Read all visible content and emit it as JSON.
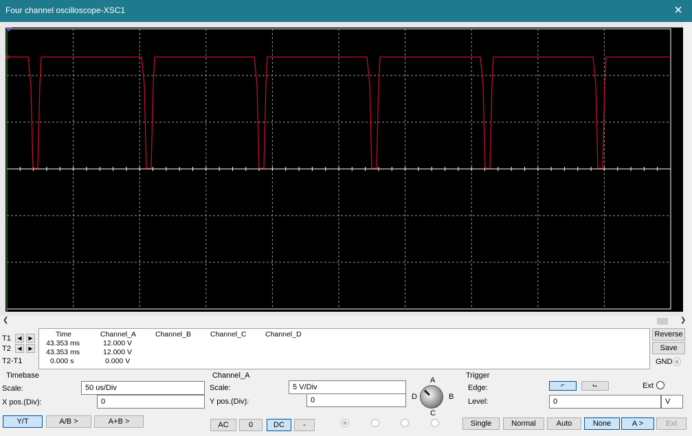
{
  "window": {
    "title": "Four channel oscilloscope-XSC1",
    "close_icon": "×"
  },
  "colors": {
    "trace": "#c8102e",
    "screen": "#000000",
    "grid": "#9a9a9a",
    "titlebar": "#1e7a8c"
  },
  "readout": {
    "t1_label": "T1",
    "t2_label": "T2",
    "t2t1_label": "T2-T1",
    "headers": [
      "Time",
      "Channel_A",
      "Channel_B",
      "Channel_C",
      "Channel_D"
    ],
    "rows": [
      [
        "43.353 ms",
        "12.000 V",
        "",
        "",
        ""
      ],
      [
        "43.353 ms",
        "12.000 V",
        "",
        "",
        ""
      ],
      [
        "0.000 s",
        "0.000 V",
        "",
        "",
        ""
      ]
    ],
    "reverse_label": "Reverse",
    "save_label": "Save",
    "gnd_label": "GND"
  },
  "timebase": {
    "title": "Timebase",
    "scale_label": "Scale:",
    "scale_value": "50 us/Div",
    "xpos_label": "X pos.(Div):",
    "xpos_value": "0",
    "yt_label": "Y/T",
    "ab_label": "A/B >",
    "aplusb_label": "A+B >"
  },
  "channel": {
    "title": "Channel_A",
    "scale_label": "Scale:",
    "scale_value": "5  V/Div",
    "ypos_label": "Y pos.(Div):",
    "ypos_value": "0",
    "ac_label": "AC",
    "zero_label": "0",
    "dc_label": "DC",
    "minus_label": "-",
    "knob_a": "A",
    "knob_b": "B",
    "knob_c": "C",
    "knob_d": "D"
  },
  "trigger": {
    "title": "Trigger",
    "edge_label": "Edge:",
    "ext_label": "Ext",
    "level_label": "Level:",
    "level_value": "0",
    "level_unit": "V",
    "single_label": "Single",
    "normal_label": "Normal",
    "auto_label": "Auto",
    "none_label": "None",
    "a_label": "A >",
    "ext_btn_label": "Ext"
  }
}
